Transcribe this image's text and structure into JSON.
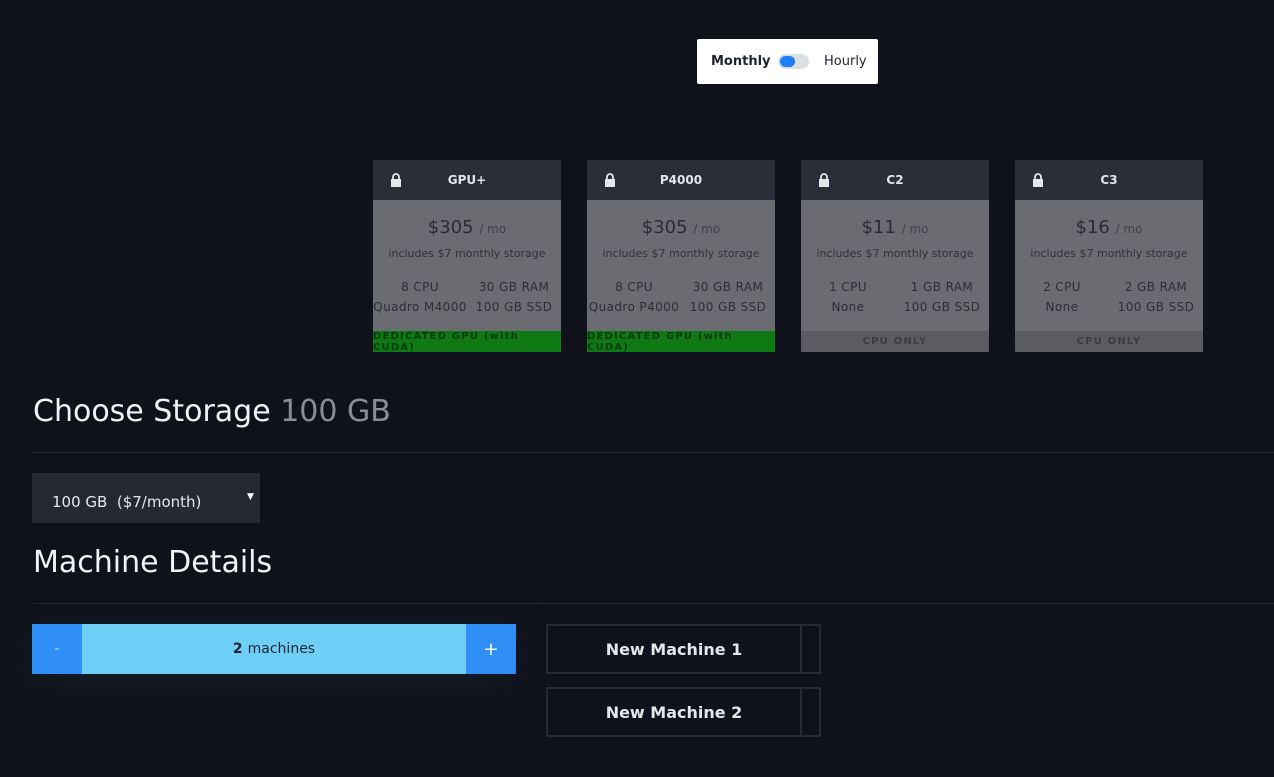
{
  "billing": {
    "monthly_label": "Monthly",
    "hourly_label": "Hourly",
    "selected": "Monthly",
    "accent": "#1e7ef7"
  },
  "plans": [
    {
      "name": "GPU+",
      "price": "$305",
      "per": "/ mo",
      "note": "includes $7 monthly storage",
      "cpu": "8 CPU",
      "ram": "30 GB RAM",
      "gpu": "Quadro M4000",
      "ssd": "100 GB SSD",
      "tag": "DEDICATED GPU (with CUDA)",
      "locked": true
    },
    {
      "name": "P4000",
      "price": "$305",
      "per": "/ mo",
      "note": "includes $7 monthly storage",
      "cpu": "8 CPU",
      "ram": "30 GB RAM",
      "gpu": "Quadro P4000",
      "ssd": "100 GB SSD",
      "tag": "DEDICATED GPU (with CUDA)",
      "locked": true
    },
    {
      "name": "C2",
      "price": "$11",
      "per": "/ mo",
      "note": "includes $7 monthly storage",
      "cpu": "1 CPU",
      "ram": "1 GB RAM",
      "gpu": "None",
      "ssd": "100 GB SSD",
      "tag": "CPU ONLY",
      "locked": true
    },
    {
      "name": "C3",
      "price": "$16",
      "per": "/ mo",
      "note": "includes $7 monthly storage",
      "cpu": "2 CPU",
      "ram": "2 GB RAM",
      "gpu": "None",
      "ssd": "100 GB SSD",
      "tag": "CPU ONLY",
      "locked": true
    }
  ],
  "storage": {
    "title": "Choose Storage",
    "size": "100 GB",
    "selected_option": "100 GB  ($7/month)"
  },
  "machine_details": {
    "title": "Machine Details",
    "minus_label": "-",
    "plus_label": "+",
    "count": "2",
    "count_unit": "machines",
    "machines": [
      "New Machine 1",
      "New Machine 2"
    ]
  },
  "colors": {
    "gpu_tag": "#0f7a14",
    "counter_button": "#2f8ff7",
    "counter_bar": "#6dcff6"
  }
}
